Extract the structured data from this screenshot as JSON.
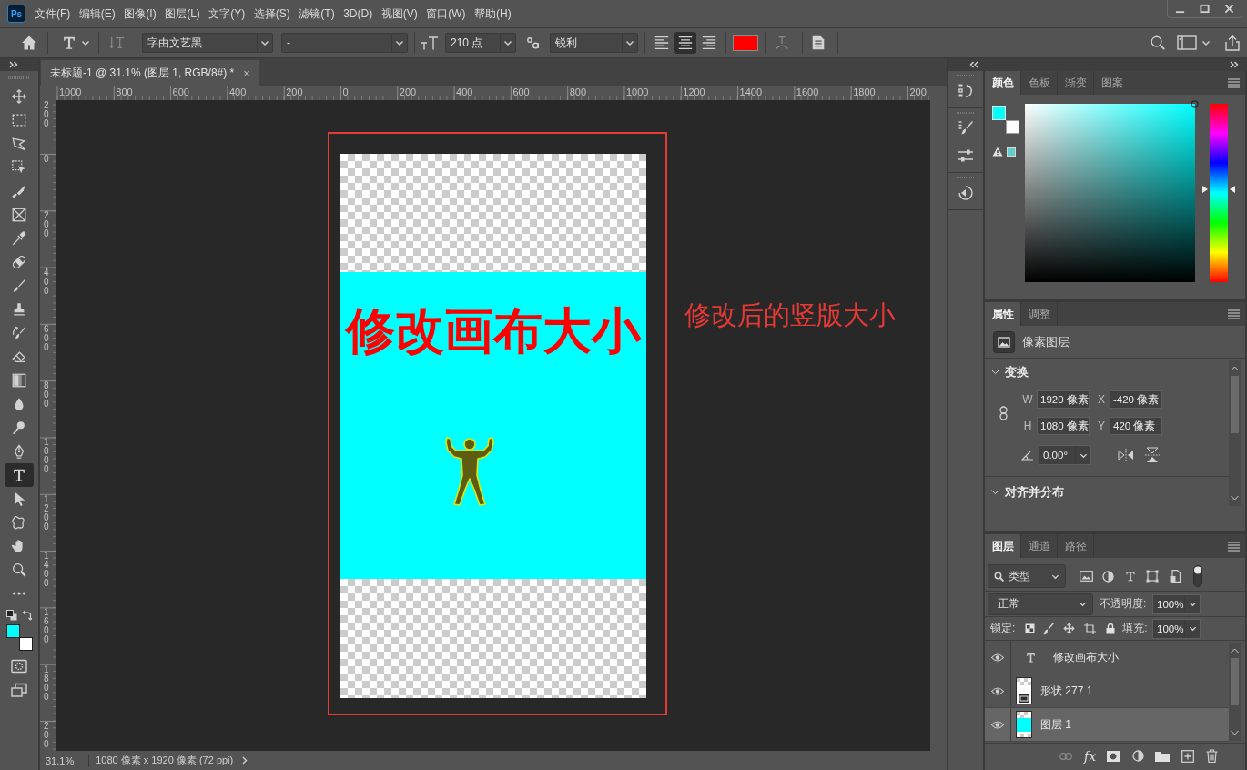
{
  "app": {
    "logo": "Ps"
  },
  "menu": [
    "文件(F)",
    "编辑(E)",
    "图像(I)",
    "图层(L)",
    "文字(Y)",
    "选择(S)",
    "滤镜(T)",
    "3D(D)",
    "视图(V)",
    "窗口(W)",
    "帮助(H)"
  ],
  "options_bar": {
    "font_family": "字由文艺黑",
    "font_style": "-",
    "font_size": "210 点",
    "anti_alias": "锐利",
    "align": [
      {
        "kind": "left",
        "selected": false
      },
      {
        "kind": "center",
        "selected": true
      },
      {
        "kind": "right",
        "selected": false
      }
    ],
    "text_color": {
      "color": "#ff0000"
    }
  },
  "tools": [
    {
      "kind": "move",
      "selected": false
    },
    {
      "kind": "marquee",
      "selected": false
    },
    {
      "kind": "lasso",
      "selected": false
    },
    {
      "kind": "object_select",
      "selected": false
    },
    {
      "kind": "slice",
      "selected": false
    },
    {
      "kind": "frame",
      "selected": false
    },
    {
      "kind": "eyedropper",
      "selected": false
    },
    {
      "kind": "healing",
      "selected": false
    },
    {
      "kind": "brush",
      "selected": false
    },
    {
      "kind": "stamp",
      "selected": false
    },
    {
      "kind": "history_brush",
      "selected": false
    },
    {
      "kind": "eraser",
      "selected": false
    },
    {
      "kind": "gradient",
      "selected": false
    },
    {
      "kind": "blur",
      "selected": false
    },
    {
      "kind": "dodge",
      "selected": false
    },
    {
      "kind": "pen",
      "selected": false
    },
    {
      "kind": "type",
      "selected": true
    },
    {
      "kind": "path_select",
      "selected": false
    },
    {
      "kind": "shape",
      "selected": false
    },
    {
      "kind": "hand",
      "selected": false
    },
    {
      "kind": "zoom",
      "selected": false
    },
    {
      "kind": "more",
      "selected": false
    }
  ],
  "toolbar_swatches": [
    {
      "kind": "foreground",
      "color": "#00ffff"
    },
    {
      "kind": "background",
      "color": "#ffffff"
    }
  ],
  "document": {
    "tab": {
      "title": "未标题-1 @ 31.1% (图层 1, RGB/8#) *",
      "close": "×"
    },
    "ruler_horizontal": [
      "1000",
      "800",
      "600",
      "400",
      "200",
      "0",
      "200",
      "400",
      "600",
      "800",
      "1000",
      "1200",
      "1400",
      "1600",
      "1800",
      "200"
    ],
    "ruler_vertical": [
      "200",
      "0",
      "200",
      "400",
      "600",
      "800",
      "1000",
      "1200",
      "1400",
      "1600",
      "1800",
      "200"
    ],
    "canvas_text": "修改画布大小",
    "annotation": "修改后的竖版大小"
  },
  "status_bar": {
    "zoom": "31.1%",
    "info": "1080 像素 x 1920 像素 (72 ppi)"
  },
  "color_panel": {
    "tabs": [
      {
        "label": "颜色",
        "selected": true
      },
      {
        "label": "色板",
        "selected": false
      },
      {
        "label": "渐变",
        "selected": false
      },
      {
        "label": "图案",
        "selected": false
      }
    ],
    "swatches": [
      {
        "kind": "foreground",
        "color": "#00ffff"
      },
      {
        "kind": "background",
        "color": "#ffffff"
      }
    ],
    "hue_slider": {
      "level": 0.52
    }
  },
  "properties_panel": {
    "tabs": [
      {
        "label": "属性",
        "selected": true
      },
      {
        "label": "调整",
        "selected": false
      }
    ],
    "layer_type": "像素图层",
    "transform": {
      "title": "变换",
      "fields": [
        {
          "label": "W",
          "value": "1920 像素"
        },
        {
          "label": "X",
          "value": "-420 像素"
        },
        {
          "label": "H",
          "value": "1080 像素"
        },
        {
          "label": "Y",
          "value": "420 像素"
        }
      ],
      "angle": "0.00°"
    },
    "align_section": {
      "title": "对齐并分布"
    }
  },
  "layers_panel": {
    "tabs": [
      {
        "label": "图层",
        "selected": true
      },
      {
        "label": "通道",
        "selected": false
      },
      {
        "label": "路径",
        "selected": false
      }
    ],
    "filter": "类型",
    "blend_mode": "正常",
    "opacity_label": "不透明度:",
    "opacity": "100%",
    "lock_label": "锁定:",
    "fill_label": "填充:",
    "fill": "100%",
    "layers": [
      {
        "kind": "text",
        "name": "修改画布大小",
        "visible": true,
        "selected": false
      },
      {
        "kind": "shape",
        "name": "形状 277 1",
        "visible": true,
        "selected": false
      },
      {
        "kind": "pixel",
        "name": "图层 1",
        "visible": true,
        "selected": true
      }
    ],
    "effects_label": "fx"
  }
}
